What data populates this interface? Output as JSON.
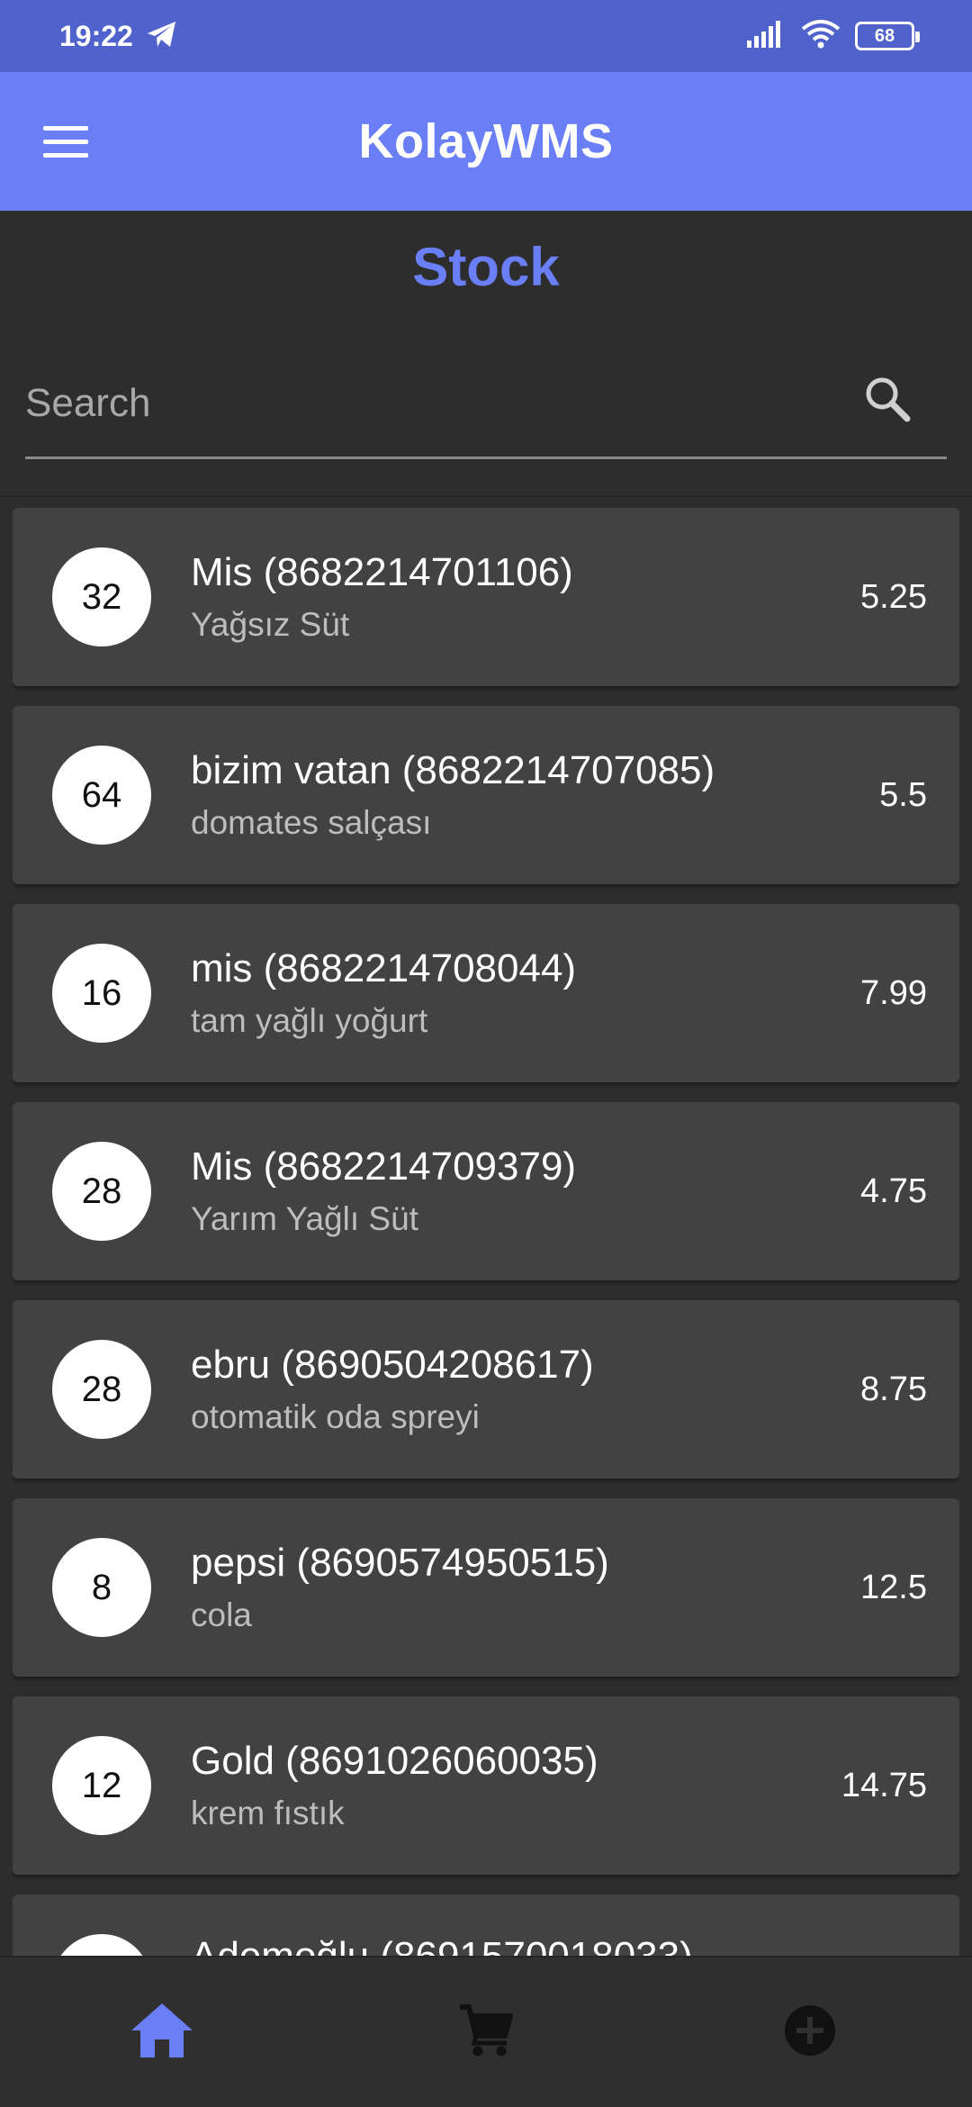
{
  "status_bar": {
    "time": "19:22",
    "battery": "68",
    "icons": [
      "telegram-icon",
      "signal-icon",
      "wifi-icon",
      "battery-icon"
    ]
  },
  "app_bar": {
    "title": "KolayWMS",
    "menu_icon": "menu-icon"
  },
  "page": {
    "title": "Stock"
  },
  "search": {
    "placeholder": "Search",
    "value": ""
  },
  "items": [
    {
      "qty": "32",
      "name": "Mis (8682214701106)",
      "desc": "Yağsız Süt",
      "price": "5.25"
    },
    {
      "qty": "64",
      "name": "bizim vatan (8682214707085)",
      "desc": "domates salçası",
      "price": "5.5"
    },
    {
      "qty": "16",
      "name": "mis (8682214708044)",
      "desc": "tam yağlı yoğurt",
      "price": "7.99"
    },
    {
      "qty": "28",
      "name": "Mis (8682214709379)",
      "desc": "Yarım Yağlı Süt",
      "price": "4.75"
    },
    {
      "qty": "28",
      "name": "ebru (8690504208617)",
      "desc": "otomatik oda spreyi",
      "price": "8.75"
    },
    {
      "qty": "8",
      "name": "pepsi (8690574950515)",
      "desc": "cola",
      "price": "12.5"
    },
    {
      "qty": "12",
      "name": "Gold (8691026060035)",
      "desc": "krem fıstık",
      "price": "14.75"
    },
    {
      "qty": "",
      "name": "Ademoğlu (8691570018033)",
      "desc": "",
      "price": ""
    }
  ],
  "bottom_nav": {
    "items": [
      "home-icon",
      "cart-icon",
      "add-circle-icon"
    ],
    "active_color": "#6a7ff6",
    "inactive_color": "#111111"
  },
  "colors": {
    "primary": "#6a7ff6",
    "status_bar": "#5062cc",
    "background": "#2d2d2d",
    "card": "#424242"
  }
}
